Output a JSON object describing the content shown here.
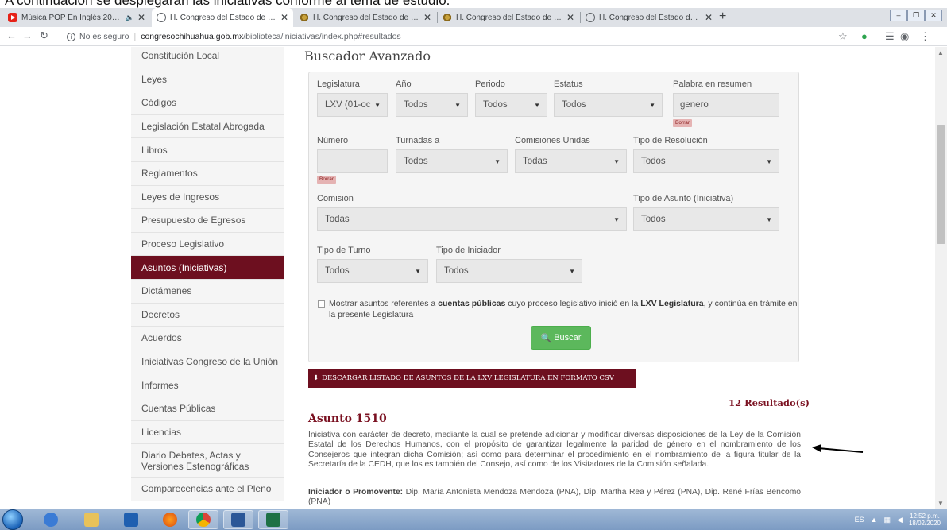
{
  "caption": "A continuación se desplegarán las iniciativas conforme al tema de estudio.",
  "tabs": [
    {
      "label": "Música POP En Inglés 2020 -",
      "icon": "youtube-icon",
      "active": false
    },
    {
      "label": "H. Congreso del Estado de Chihu",
      "icon": "globe-icon",
      "active": true
    },
    {
      "label": "H. Congreso del Estado de Chihu",
      "icon": "site-icon",
      "active": false
    },
    {
      "label": "H. Congreso del Estado de Chihu",
      "icon": "site-icon",
      "active": false
    },
    {
      "label": "H. Congreso del Estado de Chihu",
      "icon": "globe-icon",
      "active": false
    }
  ],
  "address": {
    "security": "No es seguro",
    "host": "congresochihuahua.gob.mx",
    "path": "/biblioteca/iniciativas/index.php#resultados"
  },
  "sidebar": {
    "items": [
      {
        "label": "Constitución Local"
      },
      {
        "label": "Leyes"
      },
      {
        "label": "Códigos"
      },
      {
        "label": "Legislación Estatal Abrogada"
      },
      {
        "label": "Libros"
      },
      {
        "label": "Reglamentos"
      },
      {
        "label": "Leyes de Ingresos"
      },
      {
        "label": "Presupuesto de Egresos"
      },
      {
        "label": "Proceso Legislativo"
      },
      {
        "label": "Asuntos (Iniciativas)"
      },
      {
        "label": "Dictámenes"
      },
      {
        "label": "Decretos"
      },
      {
        "label": "Acuerdos"
      },
      {
        "label": "Iniciativas Congreso de la Unión"
      },
      {
        "label": "Informes"
      },
      {
        "label": "Cuentas Públicas"
      },
      {
        "label": "Licencias"
      },
      {
        "label": "Diario Debates, Actas y Versiones Estenográficas"
      },
      {
        "label": "Comparecencias ante el Pleno"
      }
    ]
  },
  "search": {
    "title": "Buscador Avanzado",
    "legislatura": {
      "label": "Legislatura",
      "value": "LXV (01-oc"
    },
    "anio": {
      "label": "Año",
      "value": "Todos"
    },
    "periodo": {
      "label": "Periodo",
      "value": "Todos"
    },
    "estatus": {
      "label": "Estatus",
      "value": "Todos"
    },
    "palabra": {
      "label": "Palabra en resumen",
      "value": "genero",
      "clear": "Borrar"
    },
    "numero": {
      "label": "Número",
      "value": "",
      "clear": "Borrar"
    },
    "turnadas": {
      "label": "Turnadas a",
      "value": "Todos"
    },
    "comisiones_unidas": {
      "label": "Comisiones Unidas",
      "value": "Todas"
    },
    "tipo_resolucion": {
      "label": "Tipo de Resolución",
      "value": "Todos"
    },
    "comision": {
      "label": "Comisión",
      "value": "Todas"
    },
    "tipo_asunto": {
      "label": "Tipo de Asunto (Iniciativa)",
      "value": "Todos"
    },
    "tipo_turno": {
      "label": "Tipo de Turno",
      "value": "Todos"
    },
    "tipo_iniciador": {
      "label": "Tipo de Iniciador",
      "value": "Todos"
    },
    "checkbox": {
      "pre": "Mostrar asuntos referentes a ",
      "bold1": "cuentas públicas",
      "mid": " cuyo proceso legislativo inició en la ",
      "bold2": "LXV Legislatura",
      "post": ", y continúa en trámite en la presente Legislatura"
    },
    "button": "Buscar"
  },
  "download_label": "DESCARGAR LISTADO DE ASUNTOS DE LA LXV LEGISLATURA EN FORMATO CSV",
  "results_count": "12 Resultado(s)",
  "asunto": {
    "title": "Asunto 1510",
    "text": "Iniciativa con carácter de decreto, mediante la cual se pretende adicionar y modificar diversas disposiciones de la Ley de la Comisión Estatal de los Derechos Humanos, con el propósito de garantizar legalmente la paridad de género en el nombramiento de los Consejeros que integran dicha Comisión; así como para determinar el procedimiento en el nombramiento de la figura titular de la Secretaría de la CEDH, que los es también del Consejo, así como de los Visitadores de la Comisión señalada.",
    "iniciador_label": "Iniciador o Promovente:",
    "iniciador": " Dip. María Antonieta Mendoza Mendoza (PNA), Dip. Martha Rea y Pérez (PNA), Dip. René Frías Bencomo (PNA)"
  },
  "taskbar": {
    "lang": "ES",
    "time": "12:52 p.m.",
    "date": "18/02/2020"
  }
}
